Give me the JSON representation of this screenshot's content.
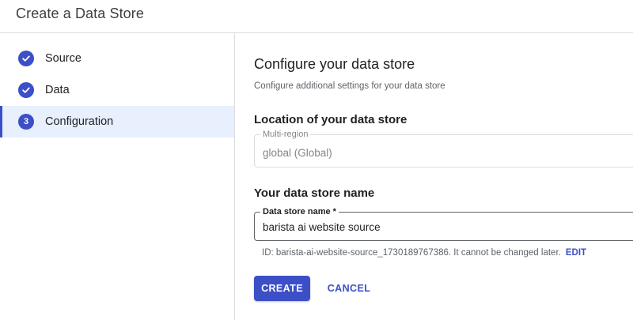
{
  "header": {
    "title": "Create a Data Store"
  },
  "stepper": {
    "steps": [
      {
        "label": "Source",
        "state": "completed",
        "icon": "check-circle-icon"
      },
      {
        "label": "Data",
        "state": "completed",
        "icon": "check-circle-icon"
      },
      {
        "label": "Configuration",
        "state": "active",
        "number": "3"
      }
    ]
  },
  "main": {
    "title": "Configure your data store",
    "subtitle": "Configure additional settings for your data store",
    "location": {
      "heading": "Location of your data store",
      "field_label": "Multi-region",
      "value": "global (Global)"
    },
    "name": {
      "heading": "Your data store name",
      "field_label": "Data store name *",
      "value": "barista ai website source",
      "id_text": "ID: barista-ai-website-source_1730189767386. It cannot be changed later.",
      "edit_label": "EDIT"
    },
    "actions": {
      "create_label": "CREATE",
      "cancel_label": "CANCEL"
    }
  },
  "colors": {
    "accent": "#3c4fc7",
    "active_step_bg": "#e8f0fe",
    "border": "#dadce0"
  }
}
